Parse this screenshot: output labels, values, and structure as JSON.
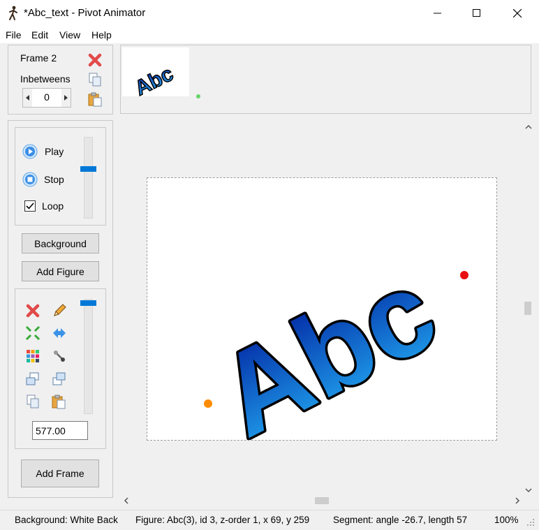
{
  "window": {
    "title": "*Abc_text - Pivot Animator",
    "minimize_label": "",
    "maximize_label": "",
    "close_label": ""
  },
  "menu": [
    "File",
    "Edit",
    "View",
    "Help"
  ],
  "frame_panel": {
    "frame_label": "Frame 2",
    "inbetweens_label": "Inbetweens",
    "inbetweens_value": "0"
  },
  "playback": {
    "play_label": "Play",
    "stop_label": "Stop",
    "loop_label": "Loop",
    "loop_checked": true,
    "speed_level": 0.38
  },
  "buttons": {
    "background": "Background",
    "add_figure": "Add Figure",
    "add_frame": "Add Frame"
  },
  "figure_tools": {
    "scale_value": "577.00",
    "scale_slider_level": 1.0
  },
  "timeline": {
    "thumbnail_text": "Abc"
  },
  "canvas": {
    "figure_text": "Abc",
    "figure_gradient_top": "#001e9e",
    "figure_gradient_bottom": "#22aaf2",
    "handle_red": "#e81010",
    "handle_orange": "#ff8c00"
  },
  "status": {
    "background": "Background: White Back",
    "figure": "Figure: Abc(3),  id 3,  z-order 1,  x 69, y 259",
    "segment": "Segment: angle -26.7,  length 57",
    "zoom": "100%"
  }
}
